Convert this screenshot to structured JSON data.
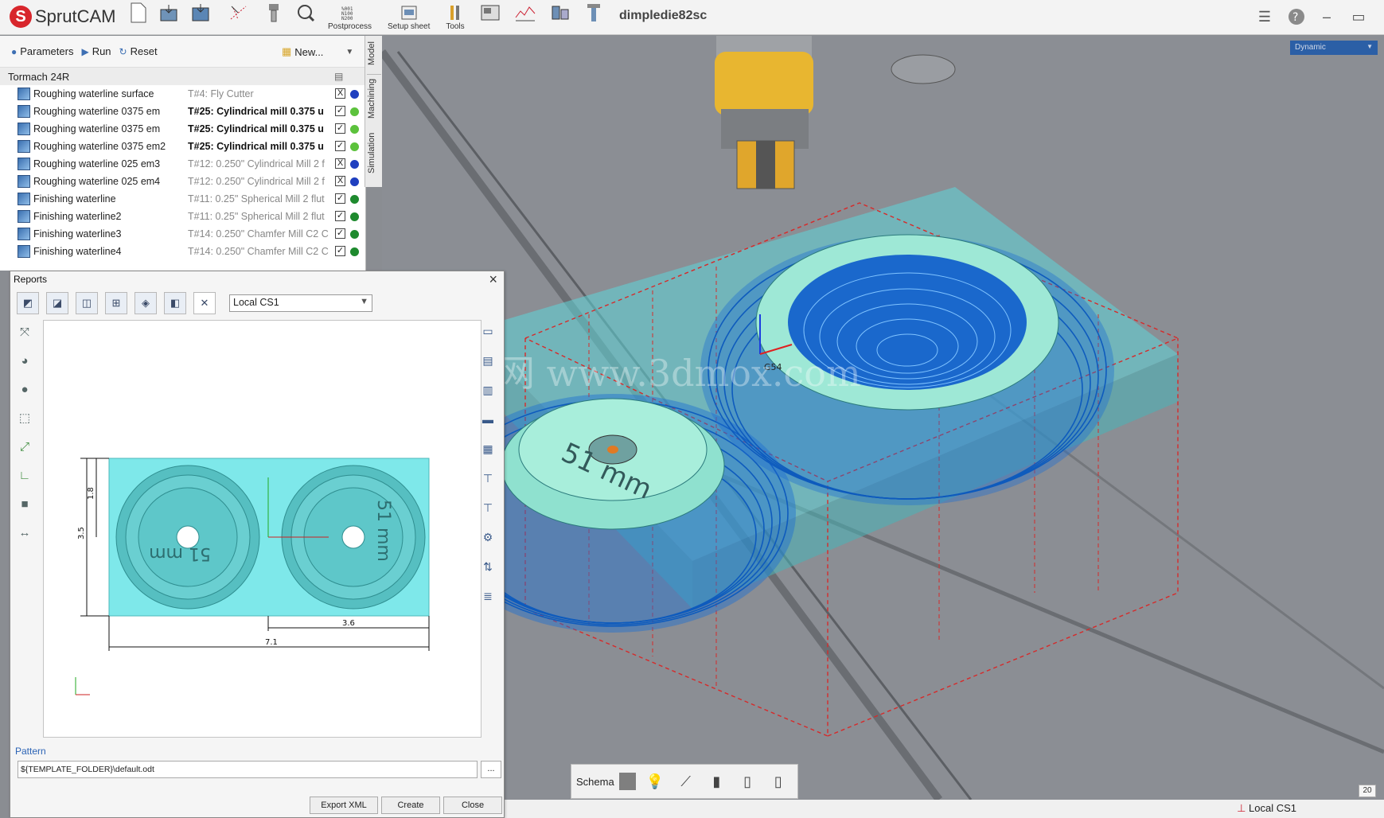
{
  "app": {
    "logo_text": "SprutCAM",
    "project_title": "dimpledie82sc"
  },
  "toolbar": {
    "postprocess_top": "%001\nN100\nN200",
    "postprocess_label": "Postprocess",
    "setup_sheet_label": "Setup sheet",
    "tools_label": "Tools"
  },
  "left_panel": {
    "parameters_label": "Parameters",
    "run_label": "Run",
    "reset_label": "Reset",
    "new_label": "New...",
    "machine_name": "Tormach 24R",
    "vertical_tabs": [
      "Model",
      "Machining",
      "Simulation"
    ],
    "operations": [
      {
        "name": "Roughing waterline surface",
        "tool": "T#4: Fly Cutter",
        "tool_bold": false,
        "checked": "X",
        "dot": "#1f3fbf"
      },
      {
        "name": "Roughing waterline 0375 em",
        "tool": "T#25: Cylindrical mill 0.375 u",
        "tool_bold": true,
        "checked": "✓",
        "dot": "#5cc23c"
      },
      {
        "name": "Roughing waterline 0375 em",
        "tool": "T#25: Cylindrical mill 0.375 u",
        "tool_bold": true,
        "checked": "✓",
        "dot": "#5cc23c"
      },
      {
        "name": "Roughing waterline 0375 em2",
        "tool": "T#25: Cylindrical mill 0.375 u",
        "tool_bold": true,
        "checked": "✓",
        "dot": "#5cc23c"
      },
      {
        "name": "Roughing waterline 025 em3",
        "tool": "T#12: 0.250\" Cylindrical Mill 2 f",
        "tool_bold": false,
        "checked": "X",
        "dot": "#1f3fbf"
      },
      {
        "name": "Roughing waterline 025 em4",
        "tool": "T#12: 0.250\" Cylindrical Mill 2 f",
        "tool_bold": false,
        "checked": "X",
        "dot": "#1f3fbf"
      },
      {
        "name": "Finishing waterline",
        "tool": "T#11: 0.25\" Spherical Mill 2 flut",
        "tool_bold": false,
        "checked": "✓",
        "dot": "#1e8a2e"
      },
      {
        "name": "Finishing waterline2",
        "tool": "T#11: 0.25\" Spherical Mill 2 flut",
        "tool_bold": false,
        "checked": "✓",
        "dot": "#1e8a2e"
      },
      {
        "name": "Finishing waterline3",
        "tool": "T#14: 0.250\" Chamfer Mill C2 C",
        "tool_bold": false,
        "checked": "✓",
        "dot": "#1e8a2e"
      },
      {
        "name": "Finishing waterline4",
        "tool": "T#14: 0.250\" Chamfer Mill C2 C",
        "tool_bold": false,
        "checked": "✓",
        "dot": "#1e8a2e"
      }
    ]
  },
  "viewport": {
    "view_mode": "Dynamic",
    "engraving_left": "51 mm",
    "engraving_right": "51 mm",
    "cs_marker": "G54",
    "watermark": "西网 www.3dmox.com",
    "schema_label": "Schema",
    "status_cs": "Local CS1",
    "zoom_badge": "20"
  },
  "reports": {
    "title": "Reports",
    "cs_select": "Local CS1",
    "drawing": {
      "dim_height_small": "1.8",
      "dim_height_total": "3.5",
      "dim_width_half": "3.6",
      "dim_width_total": "7.1",
      "engraving_left": "51 mm",
      "engraving_right": "51 mm"
    },
    "pattern_label": "Pattern",
    "pattern_value": "${TEMPLATE_FOLDER}\\default.odt",
    "browse_label": "...",
    "export_xml_label": "Export XML",
    "create_label": "Create",
    "close_label": "Close"
  }
}
